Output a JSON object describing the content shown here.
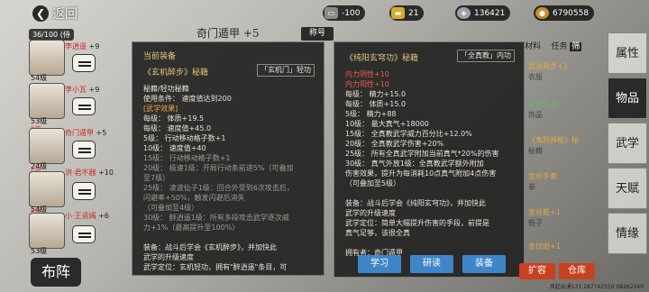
{
  "header": {
    "back_label": "返回",
    "title": "奇门遁甲 +5",
    "tab_title": "称号",
    "resources": [
      {
        "icon": "ticket-icon",
        "value": "-100"
      },
      {
        "icon": "gold-ingot-icon",
        "value": "21"
      },
      {
        "icon": "silver-icon",
        "value": "136421"
      },
      {
        "icon": "coin-icon",
        "value": "6790558"
      }
    ]
  },
  "team": {
    "count": "36/100",
    "count_suffix": "(侍",
    "button": "布阵",
    "heroes": [
      {
        "level": "54级",
        "name": "李逍遥",
        "plus": "+9"
      },
      {
        "level": "53级",
        "name": "李小瓦",
        "plus": "+9"
      },
      {
        "level": "24级",
        "name": "奇门遁甲",
        "plus": "+5",
        "tag": "上阵"
      },
      {
        "level": "54级",
        "name": "洪·君不器",
        "plus": "+10",
        "tag": "上阵"
      },
      {
        "level": "53级",
        "name": "小·王语嫣",
        "plus": "+6",
        "tag": "上阵"
      }
    ]
  },
  "panel_left": {
    "heading": "当前装备",
    "book_name": "《玄机醉步》秘籍",
    "sect": "「玄机门」轻功",
    "lines": [
      {
        "t": "秘籍/轻功秘籍",
        "c": "white"
      },
      {
        "t": "使用条件：   速度值达到200",
        "c": "white"
      },
      {
        "t": "[武学效果]",
        "c": "orange"
      },
      {
        "t": "每级：       体质+19.5",
        "c": "white"
      },
      {
        "t": "每级：       速度值+45.0",
        "c": "white"
      },
      {
        "t": "5级：   行动移动格子数+1",
        "c": "white"
      },
      {
        "t": "10级：       速度值+40",
        "c": "white"
      },
      {
        "t": "15级：   行动移动格子数+1",
        "c": "grey"
      },
      {
        "t": "20级：   极速1级：开局行动条前进5%（可叠加",
        "c": "grey"
      },
      {
        "t": "至7级）",
        "c": "grey"
      },
      {
        "t": "25级：   凌波仙子1级：回合外受到6次攻击后，",
        "c": "grey"
      },
      {
        "t": "闪避率+50%，触发闪避后消失",
        "c": "grey"
      },
      {
        "t": "（可叠加至4级）",
        "c": "grey"
      },
      {
        "t": "30级：   醉逍遥1级：所有多段攻击武学逐次威",
        "c": "grey"
      },
      {
        "t": "力+1%（最高提升至100%）",
        "c": "grey"
      },
      {
        "t": "",
        "c": "grey"
      },
      {
        "t": "装备：战斗后学会《玄机醉步》，并加快此",
        "c": "white"
      },
      {
        "t": "武学的升级速度",
        "c": "white"
      },
      {
        "t": "武学定位：玄机轻功，拥有\"醉逍遥\"条目，可",
        "c": "white"
      }
    ]
  },
  "panel_right": {
    "book_name": "《纯阳玄穹功》秘籍",
    "sect": "「全真教」内功",
    "lines": [
      {
        "t": "内力阴性+10",
        "c": "red"
      },
      {
        "t": "内力阳性+10",
        "c": "red"
      },
      {
        "t": "每级：       精力+15.0",
        "c": "white"
      },
      {
        "t": "每级：       体质+15.0",
        "c": "white"
      },
      {
        "t": "5级：   精力+88",
        "c": "white"
      },
      {
        "t": "10级：       最大真气+18000",
        "c": "white"
      },
      {
        "t": "15级：   全真教武学威力百分比+12.0%",
        "c": "white"
      },
      {
        "t": "20级：   全真教武学伤害+20%",
        "c": "white"
      },
      {
        "t": "25级：   所有全真武学附加当前真气*20%的伤害",
        "c": "white"
      },
      {
        "t": "30级：   真气外放1级：全真教武学额外附加",
        "c": "white"
      },
      {
        "t": "伤害效果，提升为每消耗10点真气附加4点伤害",
        "c": "white"
      },
      {
        "t": "（可叠加至5级）",
        "c": "white"
      },
      {
        "t": "",
        "c": "white"
      },
      {
        "t": "装备：战斗后学会《纯阳玄穹功》，并加快此",
        "c": "white"
      },
      {
        "t": "武学的升级速度",
        "c": "white"
      },
      {
        "t": "武学定位：简单大幅提升伤害的手段，前提是",
        "c": "white"
      },
      {
        "t": "真气足够，该很全真",
        "c": "white"
      },
      {
        "t": "",
        "c": "white"
      },
      {
        "t": "拥有者：奇门遁甲",
        "c": "white"
      }
    ],
    "buttons": [
      "学习",
      "研读",
      "装备"
    ]
  },
  "inventory": {
    "sub_tabs": [
      "材料",
      "任务"
    ],
    "sub_tab_badge": "筛",
    "items": [
      {
        "name": "武当悬步+1",
        "sub": "衣服"
      },
      {
        "name": "大理玉宝",
        "sub": "饰品"
      },
      {
        "name": "《鬼阴神枪》秘",
        "sub": "秘籍"
      },
      {
        "name": "金丝手套",
        "sub": "拳"
      },
      {
        "name": "金丝鞋+1",
        "sub": "鞋子"
      },
      {
        "name": "金钗斑+1",
        "sub": ""
      }
    ],
    "buttons": [
      {
        "label": "扩容",
        "color": "#c9421f"
      },
      {
        "label": "仓库",
        "color": "#c9421f"
      }
    ]
  },
  "side_nav": [
    "属性",
    "物品",
    "武学",
    "天赋",
    "情缘"
  ],
  "footer": "风起云涌131 287742559 08262340"
}
